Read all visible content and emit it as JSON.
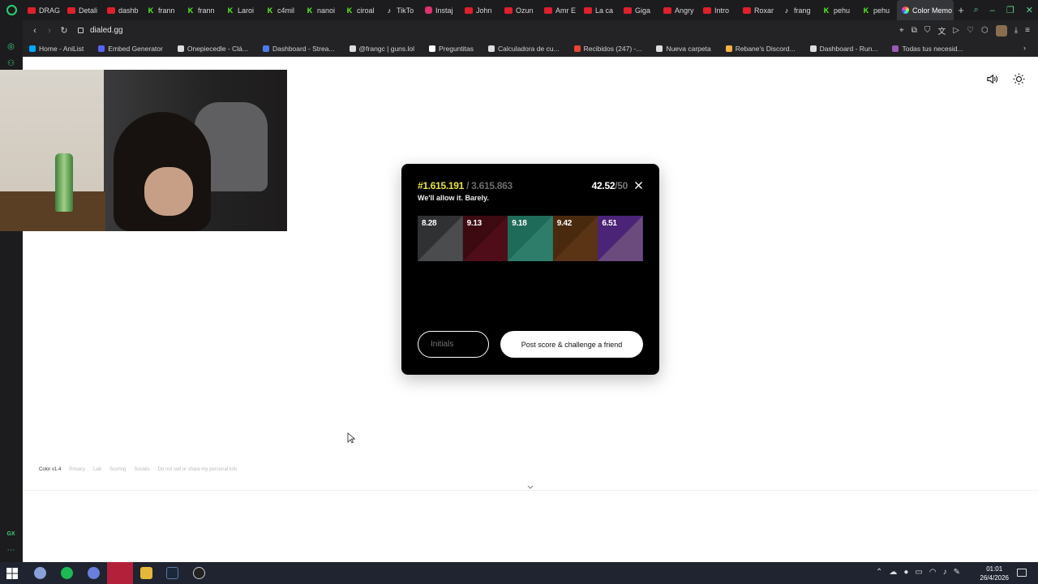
{
  "browser": {
    "tabs": [
      {
        "label": "DRAG",
        "icon": "youtube-icon",
        "color": "#e0202a"
      },
      {
        "label": "Detali",
        "icon": "youtube-icon",
        "color": "#e0202a"
      },
      {
        "label": "dashb",
        "icon": "youtube-icon",
        "color": "#e0202a"
      },
      {
        "label": "frann",
        "icon": "kick-icon",
        "color": "#53fc18"
      },
      {
        "label": "frann",
        "icon": "kick-icon",
        "color": "#53fc18"
      },
      {
        "label": "Laroi",
        "icon": "kick-icon",
        "color": "#53fc18"
      },
      {
        "label": "c4mil",
        "icon": "kick-icon",
        "color": "#53fc18"
      },
      {
        "label": "nanoi",
        "icon": "kick-icon",
        "color": "#53fc18"
      },
      {
        "label": "ciroal",
        "icon": "kick-icon",
        "color": "#53fc18"
      },
      {
        "label": "TikTo",
        "icon": "tiktok-icon",
        "color": "#ffffff"
      },
      {
        "label": "Instaj",
        "icon": "instagram-icon",
        "color": "#e1306c"
      },
      {
        "label": "John",
        "icon": "youtube-icon",
        "color": "#e0202a"
      },
      {
        "label": "Ozun",
        "icon": "youtube-icon",
        "color": "#e0202a"
      },
      {
        "label": "Amr E",
        "icon": "youtube-icon",
        "color": "#e0202a"
      },
      {
        "label": "La ca",
        "icon": "youtube-icon",
        "color": "#e0202a"
      },
      {
        "label": "Giga",
        "icon": "youtube-icon",
        "color": "#e0202a"
      },
      {
        "label": "Angry",
        "icon": "youtube-icon",
        "color": "#e0202a"
      },
      {
        "label": "Intro",
        "icon": "youtube-icon",
        "color": "#e0202a"
      },
      {
        "label": "Roxar",
        "icon": "youtube-icon",
        "color": "#e0202a"
      },
      {
        "label": "frang",
        "icon": "tiktok-icon",
        "color": "#ffffff"
      },
      {
        "label": "pehu",
        "icon": "kick-icon",
        "color": "#53fc18"
      },
      {
        "label": "pehu",
        "icon": "kick-icon",
        "color": "#53fc18"
      }
    ],
    "active_tab": {
      "label": "Color Memo",
      "icon": "color-wheel-icon"
    },
    "new_tab": "+",
    "url": "dialed.gg",
    "bookmarks": [
      {
        "label": "Home - AniList",
        "color": "#02a9ff"
      },
      {
        "label": "Embed Generator",
        "color": "#5865f2"
      },
      {
        "label": "Onepiecedle - Clá...",
        "color": "#dddddd"
      },
      {
        "label": "Dashboard - Strea...",
        "color": "#4b7bec"
      },
      {
        "label": "@frangc | guns.lol",
        "color": "#dddddd"
      },
      {
        "label": "Preguntitas",
        "color": "#ffffff"
      },
      {
        "label": "Calculadora de cu...",
        "color": "#dddddd"
      },
      {
        "label": "Recibidos (247) -...",
        "color": "#ea4335"
      },
      {
        "label": "Nueva carpeta",
        "color": "#dddddd"
      },
      {
        "label": "Rebane's Discord...",
        "color": "#f5b342"
      },
      {
        "label": "Dashboard - Run...",
        "color": "#dddddd"
      },
      {
        "label": "Todas tus necesid...",
        "color": "#9b59b6"
      }
    ]
  },
  "game": {
    "rank": "#1.615.191",
    "rank_total": " / 3.615.863",
    "tagline": "We'll allow it. Barely.",
    "score": "42.52",
    "score_max": "/50",
    "swatches": [
      {
        "score": "8.28",
        "target": "#2f3133",
        "guess": "#4a4c4e"
      },
      {
        "score": "9.13",
        "target": "#3d0a12",
        "guess": "#4e0d18"
      },
      {
        "score": "9.18",
        "target": "#1f6b5a",
        "guess": "#2e7d6b"
      },
      {
        "score": "9.42",
        "target": "#4a2a0e",
        "guess": "#5a3414"
      },
      {
        "score": "6.51",
        "target": "#4b2377",
        "guess": "#6b4a7e"
      }
    ],
    "initials_placeholder": "Initials",
    "post_button": "Post score & challenge a friend"
  },
  "footer": {
    "items": [
      "Color v1.4",
      "Privacy",
      "Lab",
      "Scoring",
      "Socials",
      "Do not sell or share my personal info"
    ]
  },
  "taskbar": {
    "time": "01:01",
    "date": "26/4/2026"
  }
}
